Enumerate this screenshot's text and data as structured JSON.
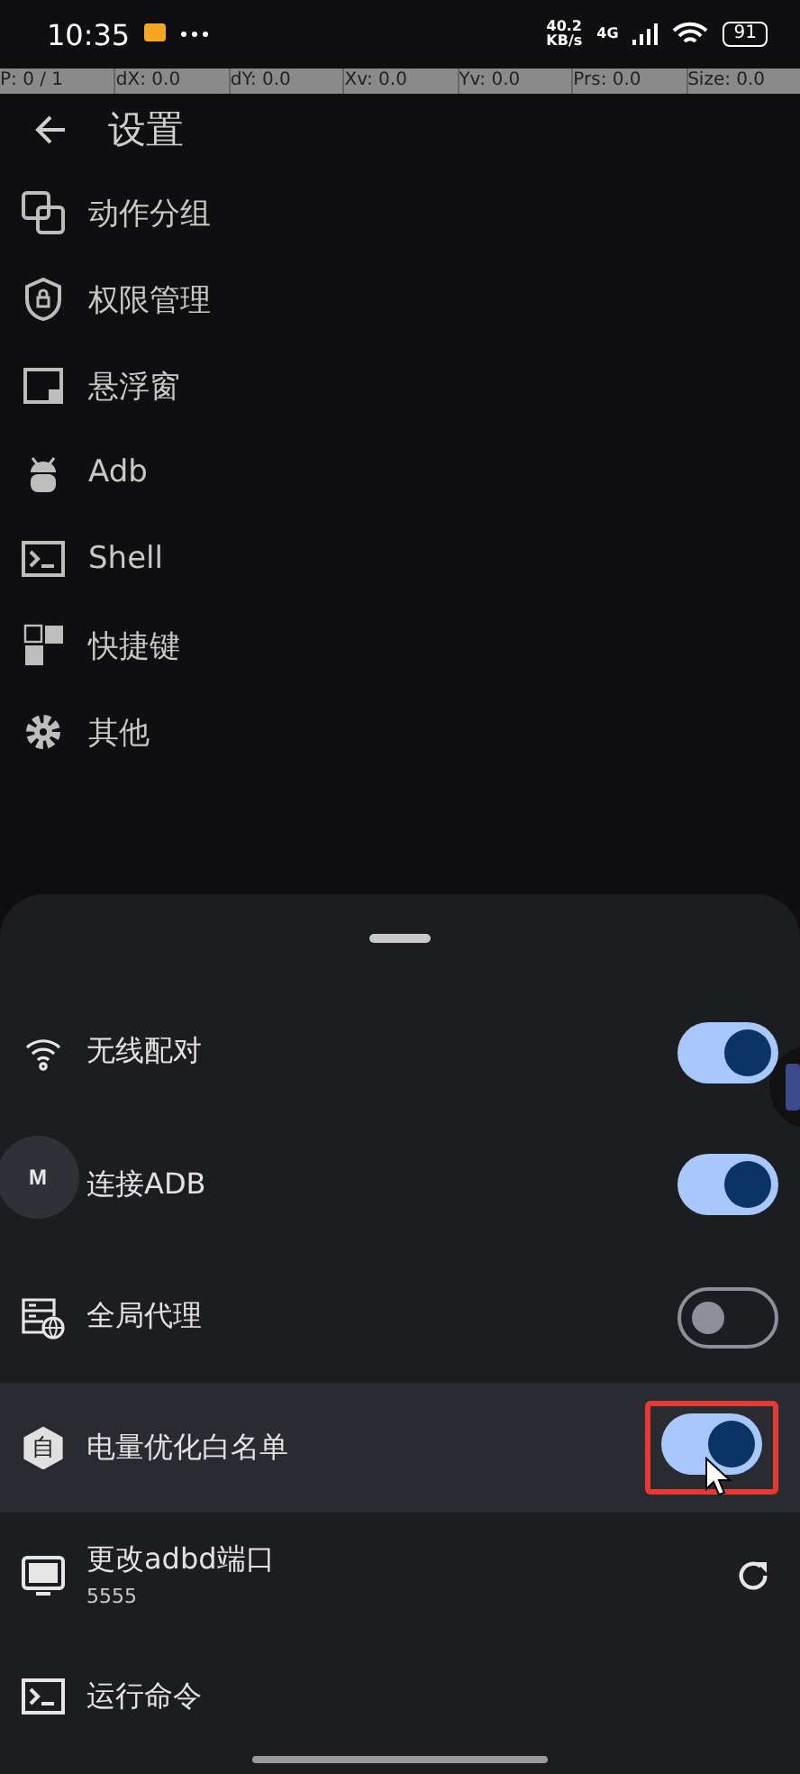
{
  "status_bar": {
    "time": "10:35",
    "net_speed": "40.2",
    "net_unit": "KB/s",
    "network": "4G",
    "battery": "91"
  },
  "pointer_bar": [
    "P: 0 / 1",
    "dX: 0.0",
    "dY: 0.0",
    "Xv: 0.0",
    "Yv: 0.0",
    "Prs: 0.0",
    "Size: 0.0"
  ],
  "header": {
    "title": "设置"
  },
  "menu": [
    {
      "kind": "group",
      "label": "动作分组"
    },
    {
      "kind": "shield",
      "label": "权限管理"
    },
    {
      "kind": "window",
      "label": "悬浮窗"
    },
    {
      "kind": "android",
      "label": "Adb"
    },
    {
      "kind": "terminal",
      "label": "Shell"
    },
    {
      "kind": "keys",
      "label": "快捷键"
    },
    {
      "kind": "gear",
      "label": "其他"
    }
  ],
  "sheet": {
    "rows": [
      {
        "kind": "switch",
        "label": "无线配对",
        "on": true,
        "highlighted": false
      },
      {
        "kind": "switch",
        "label": "连接ADB",
        "on": true,
        "highlighted": false
      },
      {
        "kind": "switch",
        "label": "全局代理",
        "on": false,
        "highlighted": false
      },
      {
        "kind": "switch",
        "badge": "自",
        "label": "电量优化白名单",
        "on": true,
        "highlighted": true
      },
      {
        "kind": "action",
        "label": "更改adbd端口",
        "subtitle": "5555"
      },
      {
        "kind": "plain",
        "label": "运行命令"
      }
    ]
  },
  "floating_button": {
    "label": "M"
  }
}
